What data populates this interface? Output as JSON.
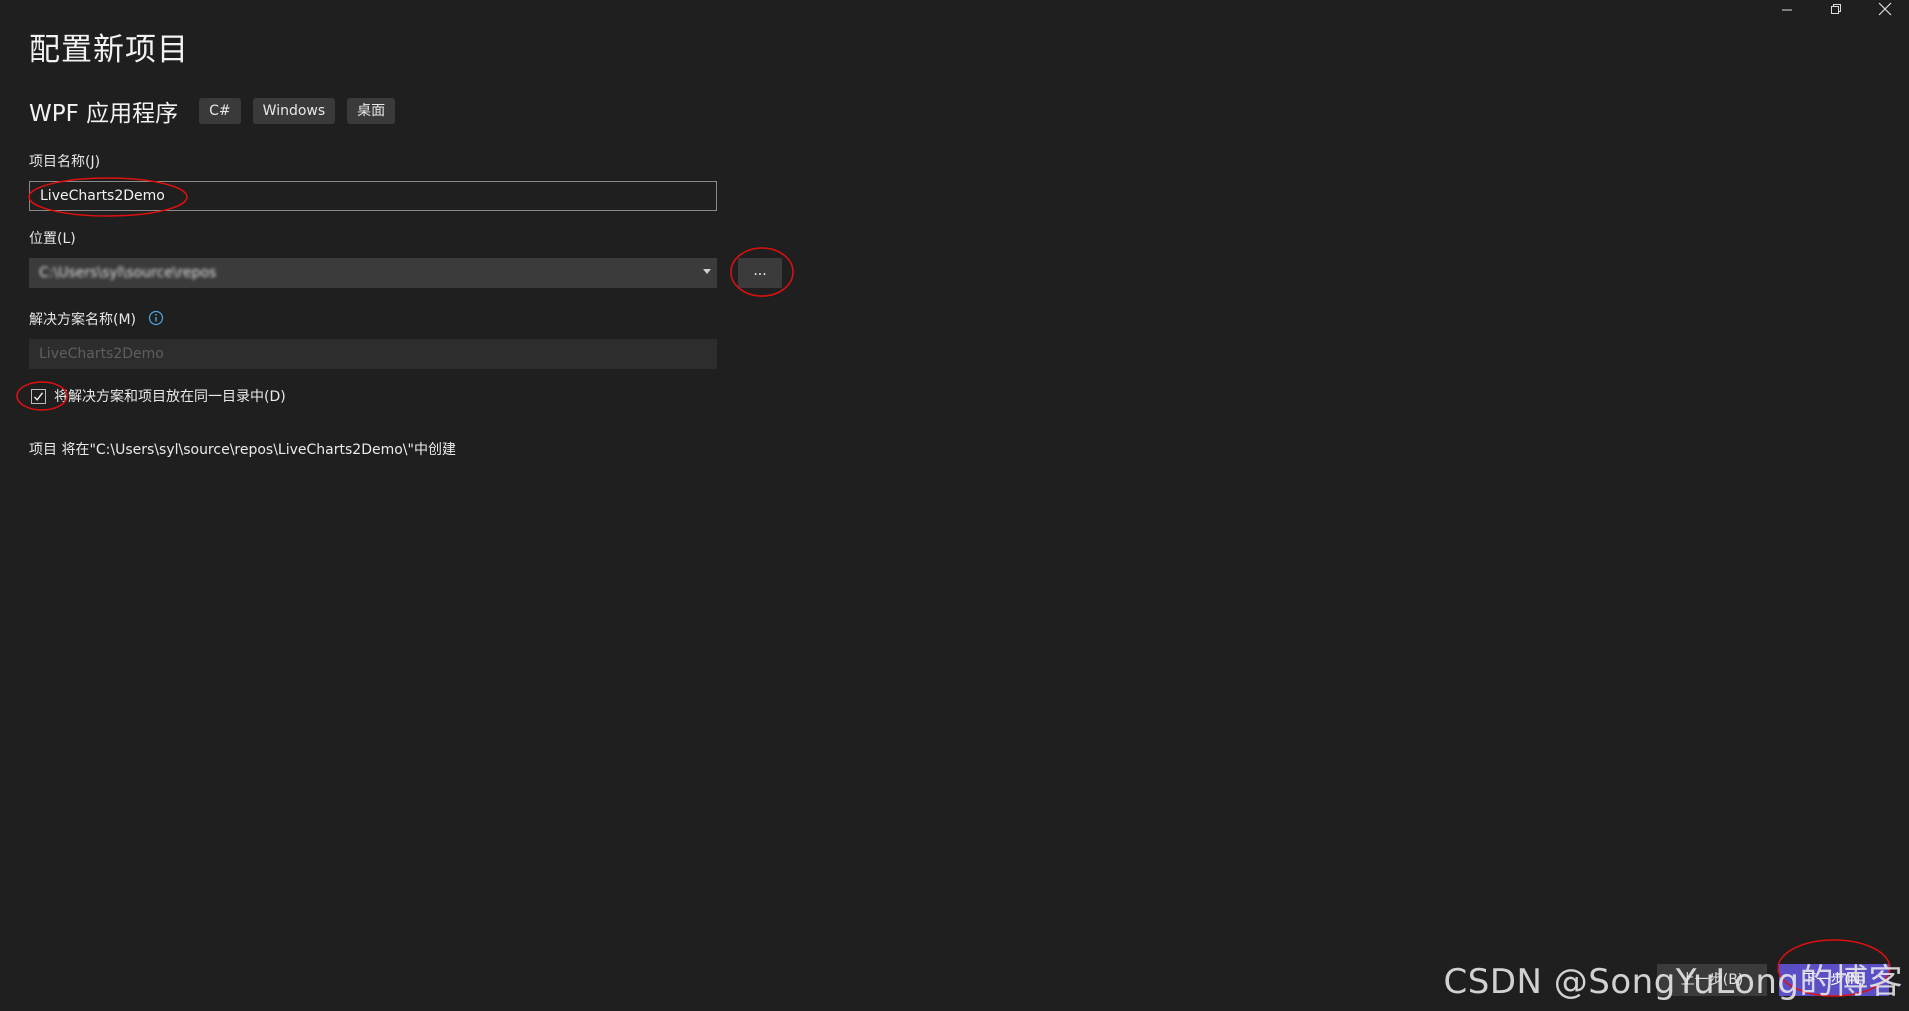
{
  "page": {
    "title": "配置新项目"
  },
  "template": {
    "name": "WPF 应用程序",
    "tags": [
      "C#",
      "Windows",
      "桌面"
    ]
  },
  "project_name": {
    "label": "项目名称(J)",
    "value": "LiveCharts2Demo"
  },
  "location": {
    "label": "位置(L)",
    "value": "C:\\Users\\syl\\source\\repos",
    "browse_label": "..."
  },
  "solution_name": {
    "label": "解决方案名称(M)",
    "placeholder": "LiveCharts2Demo"
  },
  "same_directory": {
    "label": "将解决方案和项目放在同一目录中(D)",
    "checked": true
  },
  "path_info": "项目 将在\"C:\\Users\\syl\\source\\repos\\LiveCharts2Demo\\\"中创建",
  "buttons": {
    "back": "上一步(B)",
    "next": "下一步(N)"
  },
  "watermark": "CSDN @SongYuLong的博客",
  "colors": {
    "background": "#1f1f1f",
    "accent": "#5a4fc4",
    "annotation": "#e01010",
    "info_icon": "#4fa3e0"
  }
}
